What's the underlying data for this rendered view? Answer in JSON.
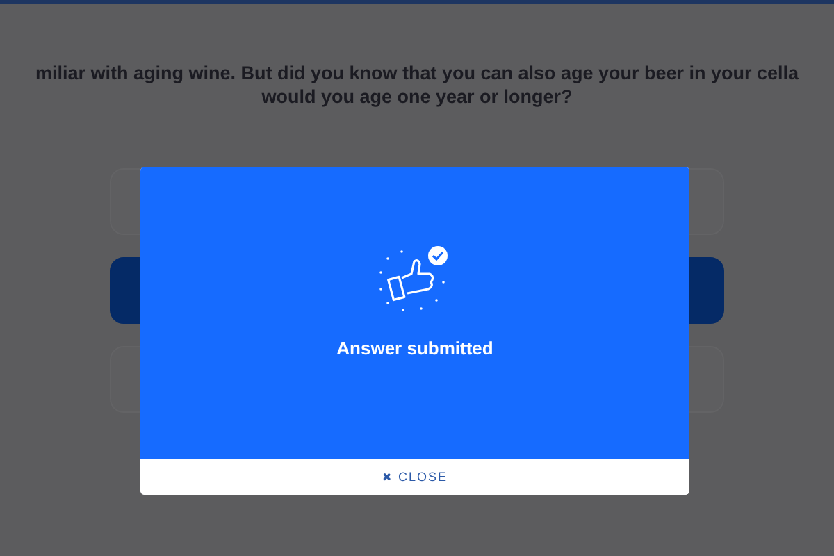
{
  "question": {
    "lines": [
      "miliar with aging wine. But did you know that you can also age your beer in your cella",
      "would you age one year or longer?"
    ]
  },
  "options": [
    {
      "selected": false
    },
    {
      "selected": true
    },
    {
      "selected": false
    }
  ],
  "modal": {
    "message": "Answer submitted",
    "close_icon": "✖",
    "close_label": "CLOSE"
  }
}
